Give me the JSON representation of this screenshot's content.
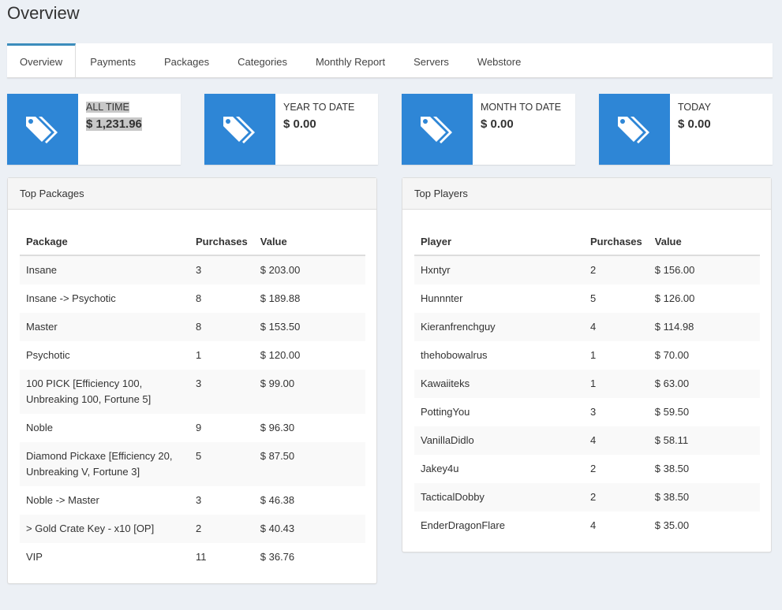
{
  "page": {
    "title": "Overview"
  },
  "tabs": [
    "Overview",
    "Payments",
    "Packages",
    "Categories",
    "Monthly Report",
    "Servers",
    "Webstore"
  ],
  "stats": [
    {
      "label": "ALL TIME",
      "value": "$ 1,231.96"
    },
    {
      "label": "YEAR TO DATE",
      "value": "$ 0.00"
    },
    {
      "label": "MONTH TO DATE",
      "value": "$ 0.00"
    },
    {
      "label": "TODAY",
      "value": "$ 0.00"
    }
  ],
  "icons": {
    "stat": "tags-icon"
  },
  "colors": {
    "accent": "#2e86d6",
    "tab_active": "#3c8dbc"
  },
  "top_packages": {
    "title": "Top Packages",
    "headers": [
      "Package",
      "Purchases",
      "Value"
    ],
    "rows": [
      [
        "Insane",
        "3",
        "$ 203.00"
      ],
      [
        "Insane -> Psychotic",
        "8",
        "$ 189.88"
      ],
      [
        "Master",
        "8",
        "$ 153.50"
      ],
      [
        "Psychotic",
        "1",
        "$ 120.00"
      ],
      [
        "100 PICK [Efficiency 100, Unbreaking 100, Fortune 5]",
        "3",
        "$ 99.00"
      ],
      [
        "Noble",
        "9",
        "$ 96.30"
      ],
      [
        "Diamond Pickaxe [Efficiency 20, Unbreaking V, Fortune 3]",
        "5",
        "$ 87.50"
      ],
      [
        "Noble -> Master",
        "3",
        "$ 46.38"
      ],
      [
        "> Gold Crate Key - x10 [OP]",
        "2",
        "$ 40.43"
      ],
      [
        "VIP",
        "11",
        "$ 36.76"
      ]
    ]
  },
  "top_players": {
    "title": "Top Players",
    "headers": [
      "Player",
      "Purchases",
      "Value"
    ],
    "rows": [
      [
        "Hxntyr",
        "2",
        "$ 156.00"
      ],
      [
        "Hunnnter",
        "5",
        "$ 126.00"
      ],
      [
        "Kieranfrenchguy",
        "4",
        "$ 114.98"
      ],
      [
        "thehobowalrus",
        "1",
        "$ 70.00"
      ],
      [
        "Kawaiiteks",
        "1",
        "$ 63.00"
      ],
      [
        "PottingYou",
        "3",
        "$ 59.50"
      ],
      [
        "VanillaDidlo",
        "4",
        "$ 58.11"
      ],
      [
        "Jakey4u",
        "2",
        "$ 38.50"
      ],
      [
        "TacticalDobby",
        "2",
        "$ 38.50"
      ],
      [
        "EnderDragonFlare",
        "4",
        "$ 35.00"
      ]
    ]
  }
}
